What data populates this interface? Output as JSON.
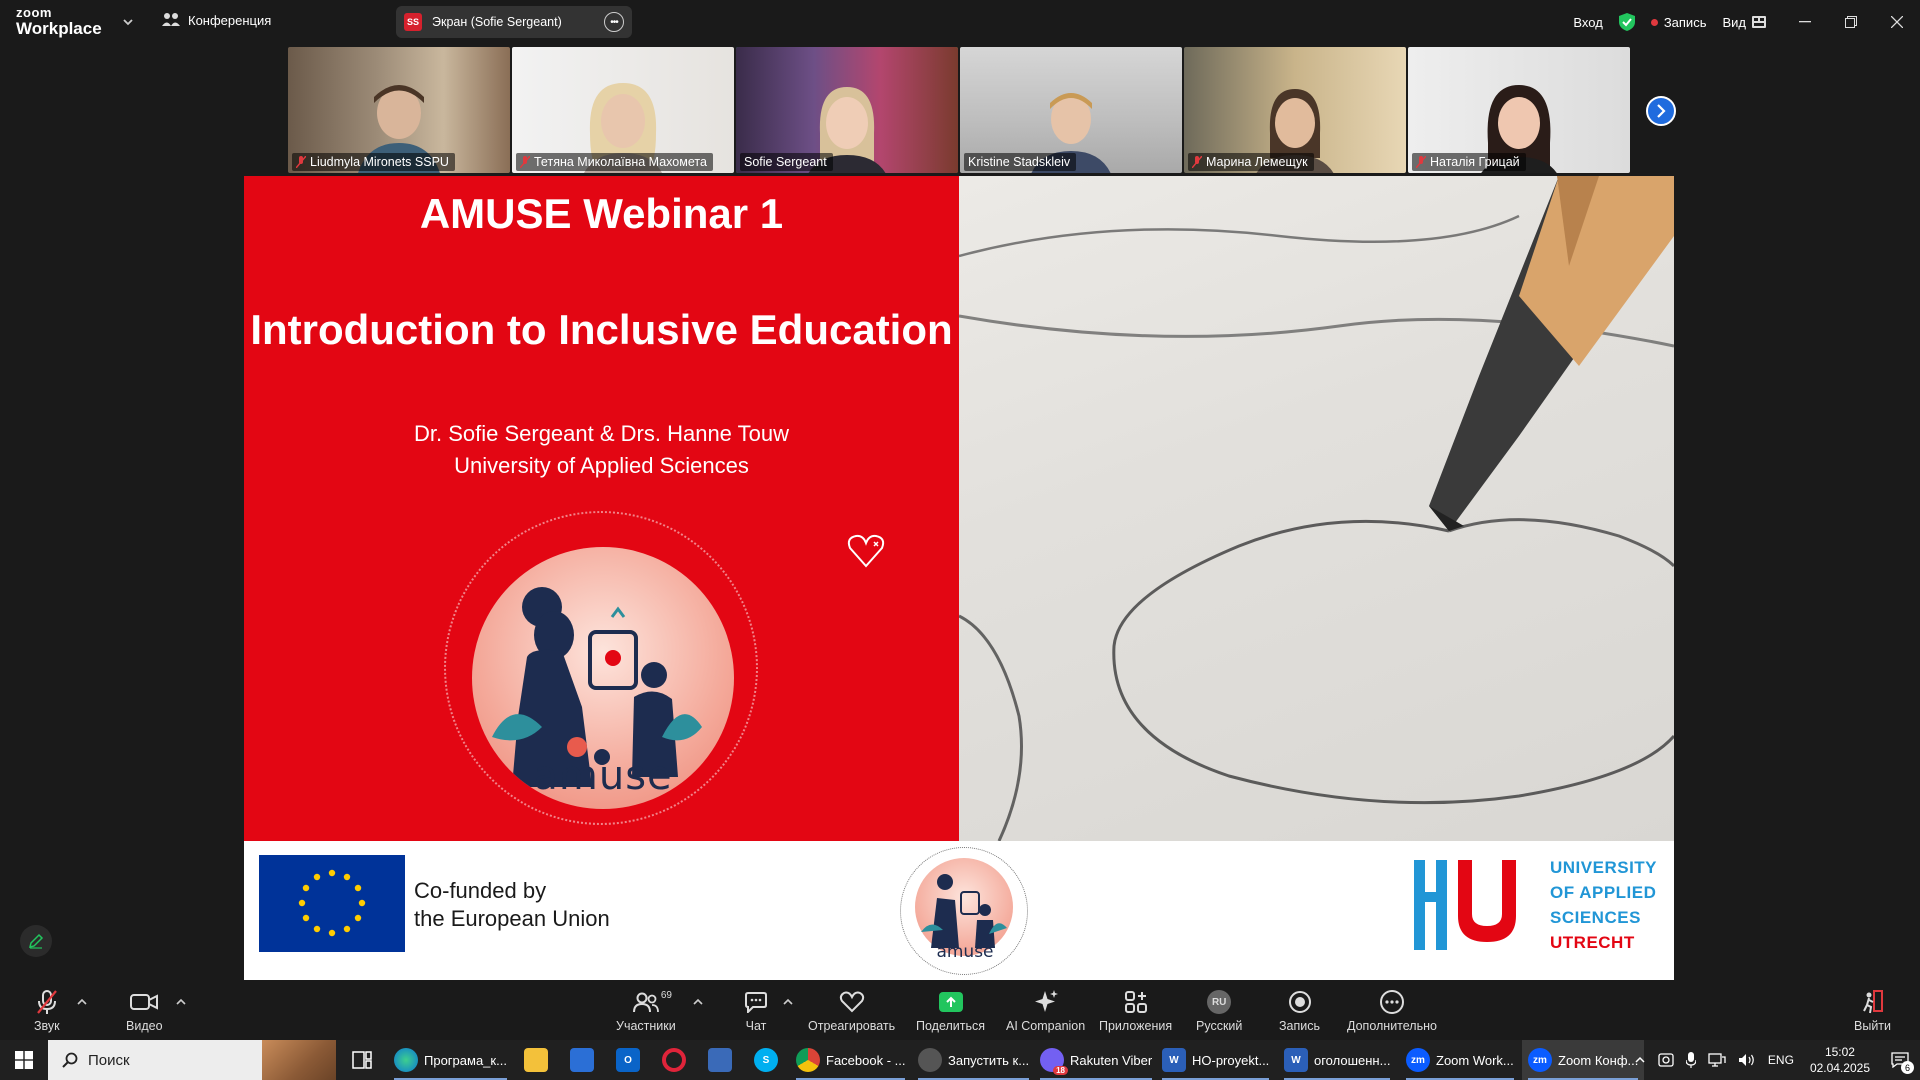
{
  "app": {
    "logo_line1": "zoom",
    "logo_line2": "Workplace",
    "conference_label": "Конференция",
    "screen_share_initials": "SS",
    "screen_share_label": "Экран (Sofie Sergeant)",
    "signin_label": "Вход",
    "recording_label": "Запись",
    "view_label": "Вид"
  },
  "participants": [
    {
      "name": "Liudmyla Mironets SSPU",
      "muted": true
    },
    {
      "name": "Тетяна Миколаївна Махомета",
      "muted": true
    },
    {
      "name": "Sofie Sergeant",
      "muted": false,
      "active": true
    },
    {
      "name": "Kristine Stadskleiv",
      "muted": false
    },
    {
      "name": "Марина Лемещук",
      "muted": true
    },
    {
      "name": "Наталія Грицай",
      "muted": true
    }
  ],
  "slide": {
    "title": "AMUSE Webinar 1",
    "subtitle": "Introduction to Inclusive Education",
    "authors": "Dr. Sofie Sergeant & Drs. Hanne Touw",
    "institution": "University of Applied Sciences",
    "logo_word": "amuse",
    "eu_text_line1": "Co-funded by",
    "eu_text_line2": "the European Union",
    "footer_logo_word": "amuse",
    "hu_lines": [
      "UNIVERSITY",
      "OF APPLIED",
      "SCIENCES",
      "UTRECHT"
    ]
  },
  "toolbar": {
    "audio": "Звук",
    "video": "Видео",
    "participants": "Участники",
    "participants_count": "69",
    "chat": "Чат",
    "react": "Отреагировать",
    "share": "Поделиться",
    "ai": "AI Companion",
    "apps": "Приложения",
    "lang_badge": "RU",
    "lang": "Русский",
    "record": "Запись",
    "more": "Дополнительно",
    "leave": "Выйти"
  },
  "taskbar": {
    "search_placeholder": "Поиск",
    "apps": [
      {
        "label": "Програма_к...",
        "icon": "edge-icon"
      },
      {
        "label": "Facebook - ...",
        "icon": "chrome-icon"
      },
      {
        "label": "Запустить к...",
        "icon": "app-icon"
      },
      {
        "label": "Rakuten Viber",
        "icon": "viber-icon",
        "badge": "18"
      },
      {
        "label": "НО-proyekt...",
        "icon": "word-icon"
      },
      {
        "label": "оголошенн...",
        "icon": "word-icon"
      },
      {
        "label": "Zoom Work...",
        "icon": "zoom-icon"
      },
      {
        "label": "Zoom Конф...",
        "icon": "zoom-icon"
      }
    ],
    "lang": "ENG",
    "time": "15:02",
    "date": "02.04.2025",
    "notif_count": "6"
  }
}
